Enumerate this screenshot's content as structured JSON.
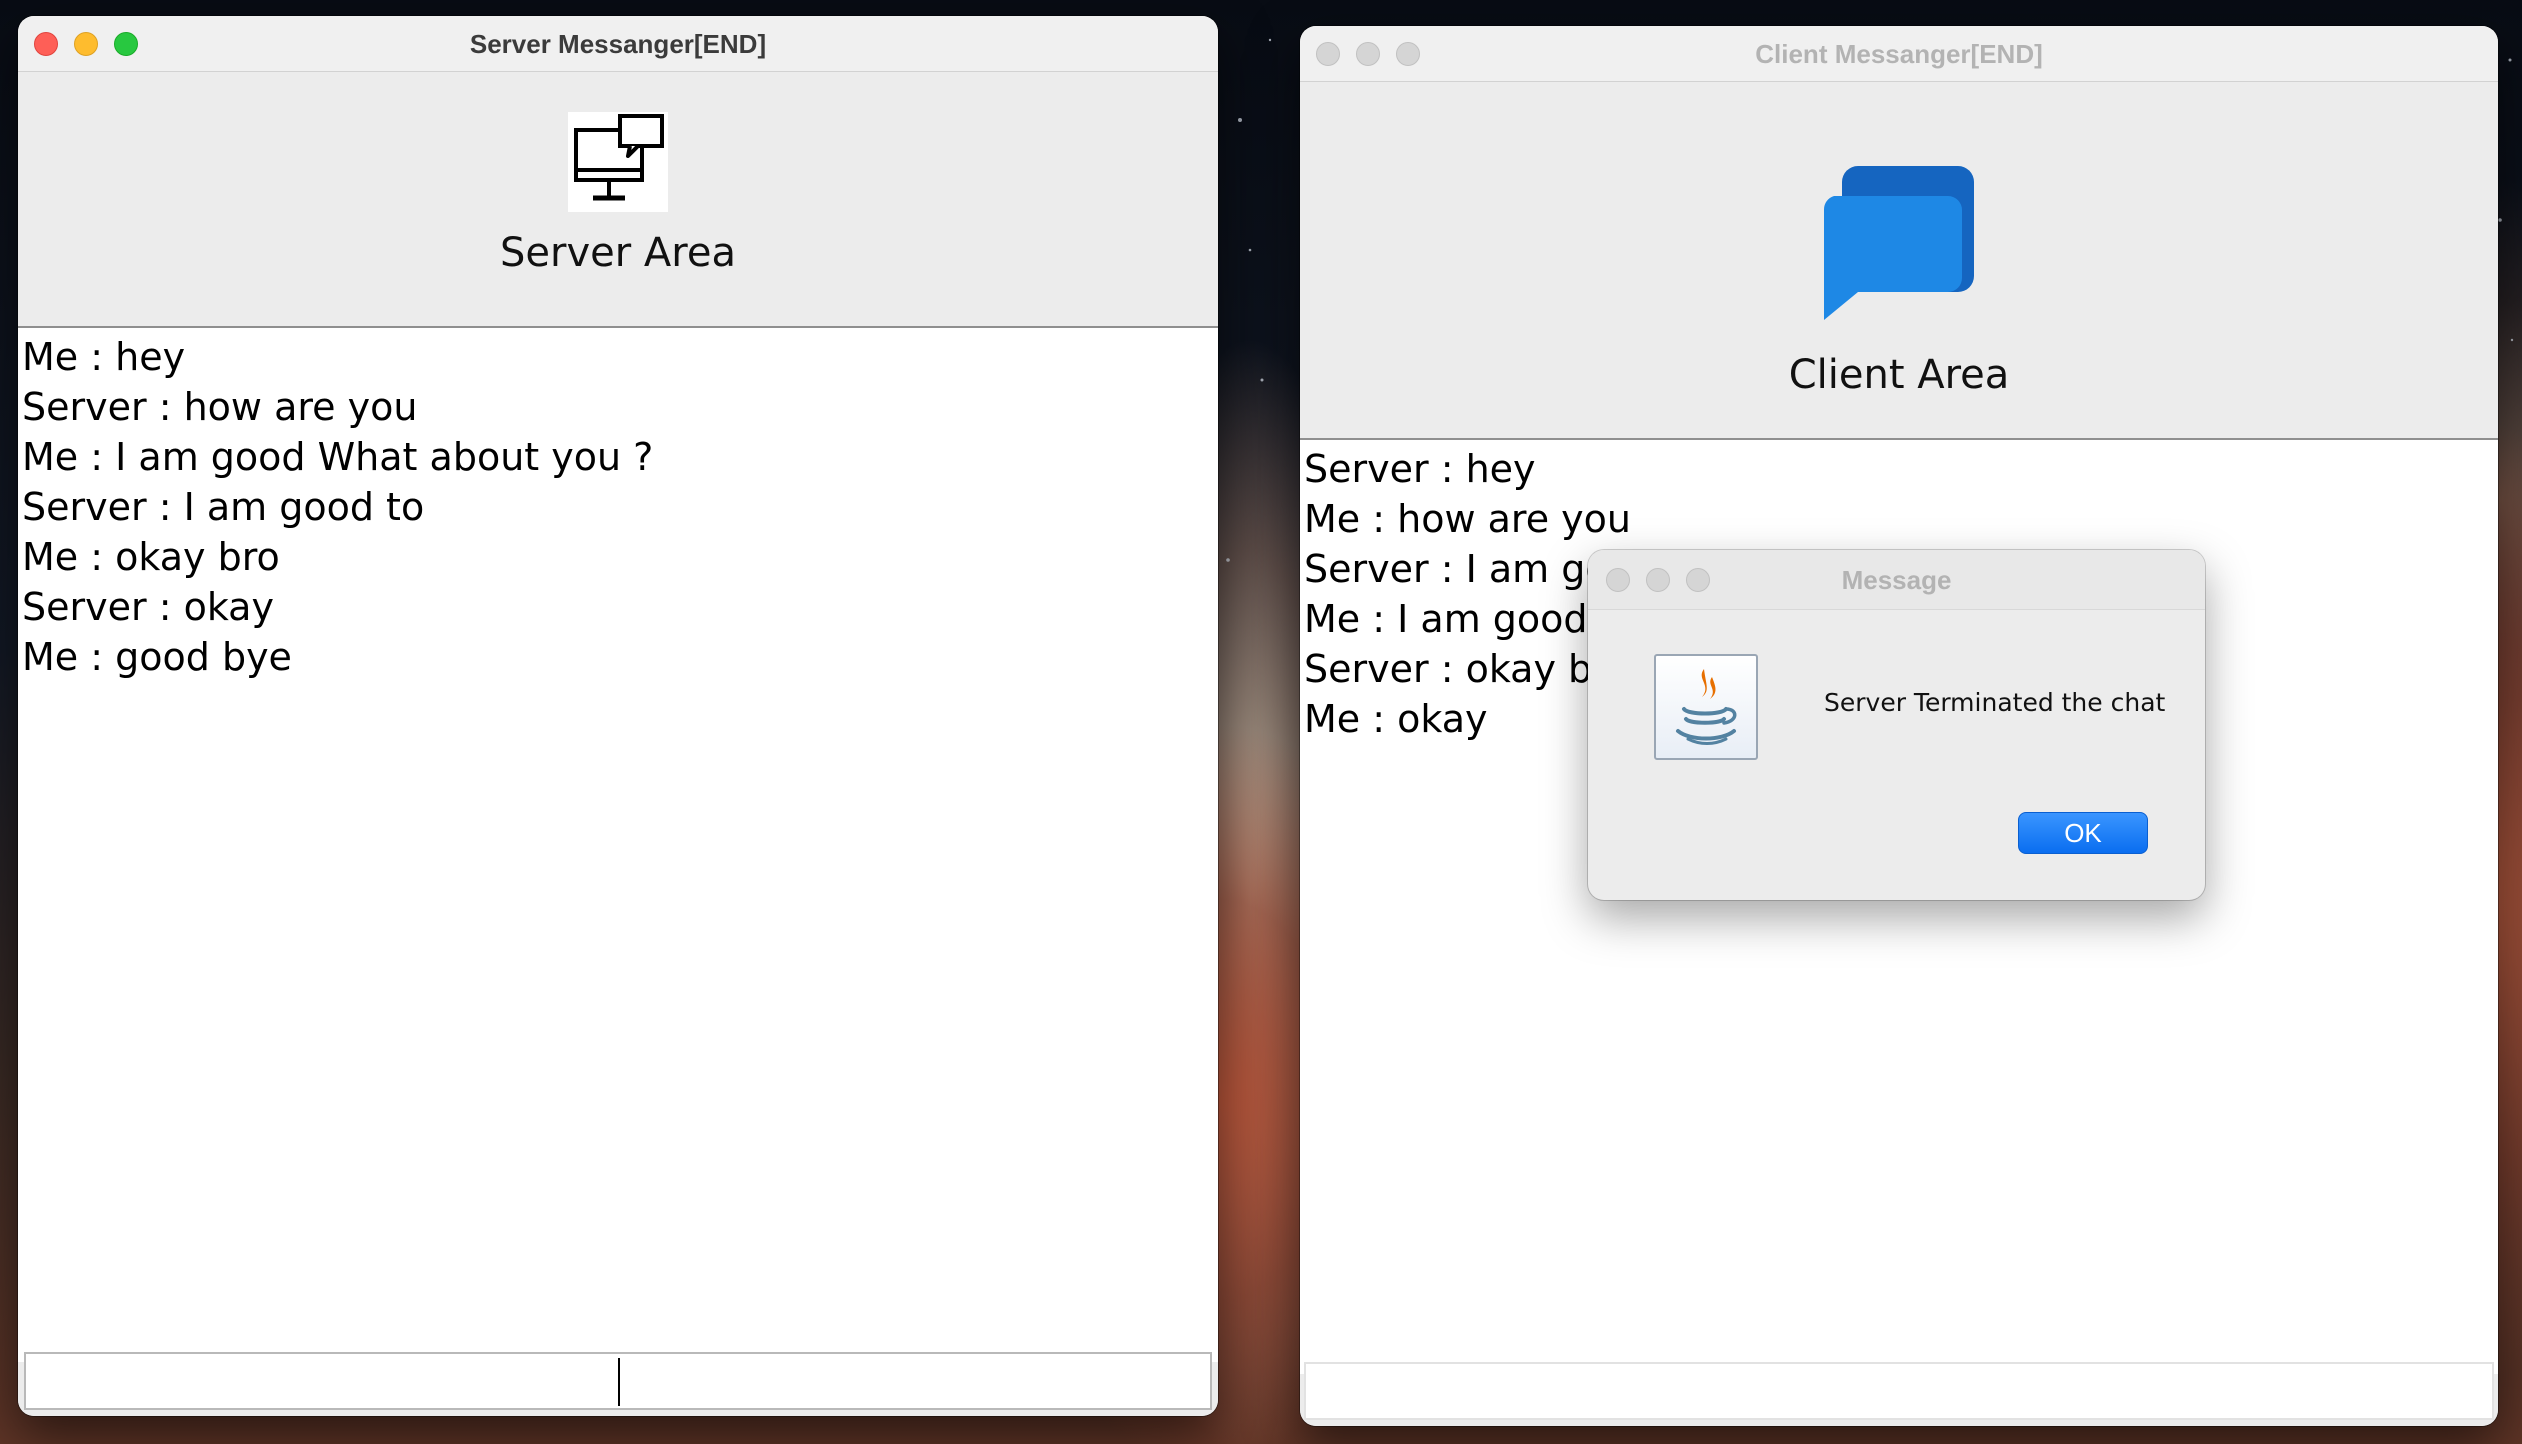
{
  "server_window": {
    "title": "Server Messanger[END]",
    "area_label": "Server Area",
    "icon": "desktop-chat-icon",
    "messages": [
      "Me : hey",
      "Server : how are you",
      "Me : I am good What about you ?",
      "Server : I am good to",
      "Me : okay bro",
      "Server : okay",
      "Me : good bye"
    ],
    "input_value": ""
  },
  "client_window": {
    "title": "Client Messanger[END]",
    "area_label": "Client Area",
    "icon": "chat-bubbles-icon",
    "messages": [
      "Server : hey",
      "Me : how are you",
      "Server : I am good What about you ?",
      "Me : I am good to",
      "Server : okay bro",
      "Me : okay"
    ],
    "input_value": ""
  },
  "dialog": {
    "title": "Message",
    "icon": "java-icon",
    "message": "Server Terminated the chat",
    "ok_label": "OK"
  },
  "colors": {
    "accent_blue": "#0a6ef0",
    "chat_icon_blue": "#1e88e5",
    "close_red": "#fe5f57",
    "minimize_yellow": "#febc2e",
    "zoom_green": "#28c840"
  }
}
